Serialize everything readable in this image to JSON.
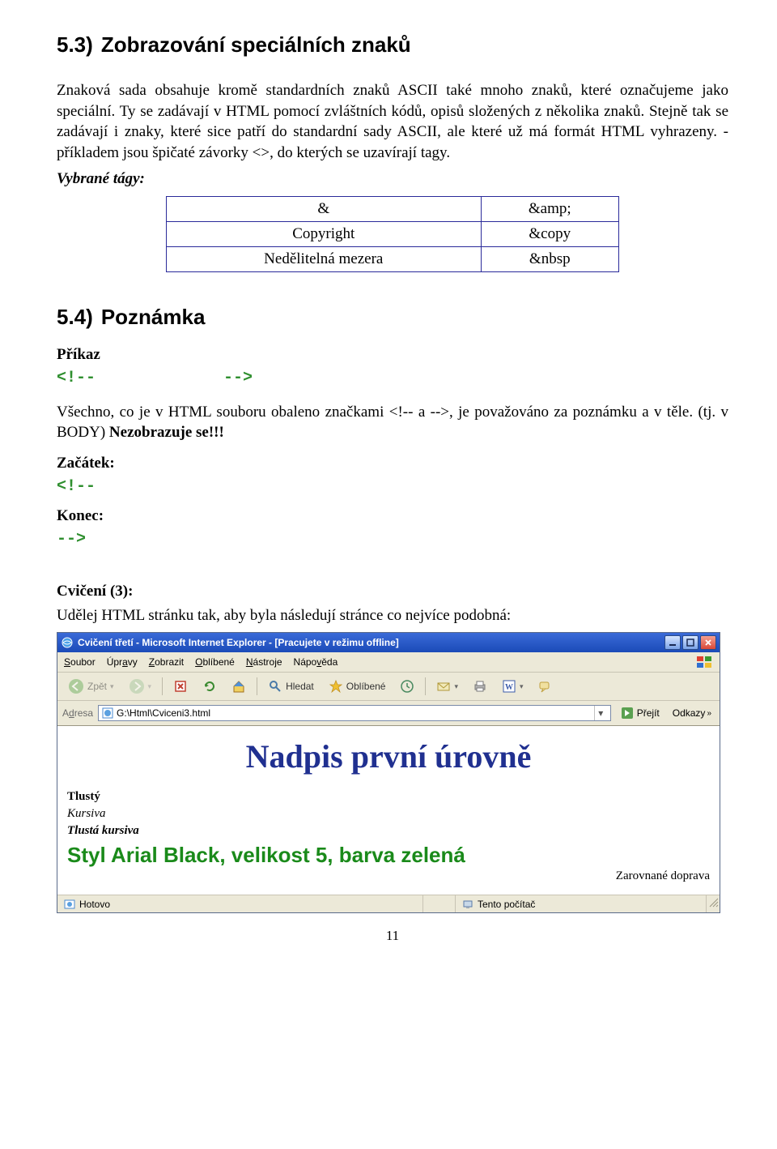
{
  "sections": {
    "s53": {
      "num": "5.3)",
      "title": "Zobrazování speciálních znaků"
    },
    "s54": {
      "num": "5.4)",
      "title": "Poznámka"
    }
  },
  "para1": "Znaková sada obsahuje kromě standardních znaků ASCII také mnoho znaků, které označujeme jako speciální. Ty se zadávají v HTML pomocí zvláštních kódů, opisů složených z několika znaků. Stejně tak se zadávají i znaky, které sice patří do standardní sady ASCII, ale které už má formát HTML vyhrazeny. - příkladem jsou špičaté závorky <>, do kterých se uzavírají tagy.",
  "vybrane_tagy_label": "Vybrané tágy:",
  "entity_table": [
    {
      "name": "&",
      "code": "&amp;"
    },
    {
      "name": "Copyright",
      "code": "&copy"
    },
    {
      "name": "Nedělitelná mezera",
      "code": "&nbsp"
    }
  ],
  "prikaz_label": "Příkaz",
  "comment_syntax": {
    "open": "<!--",
    "close": "-->"
  },
  "para2": "Všechno, co je v HTML souboru obaleno značkami <!-- a -->, je považováno za poznámku a v těle. (tj. v BODY) Nezobrazuje se!!!",
  "nezobrazuje_bold": "Nezobrazuje se!!!",
  "zacatek_label": "Začátek:",
  "konec_label": "Konec:",
  "cviceni_label": "Cvičení (3):",
  "cviceni_text": "Udělej HTML stránku tak, aby byla následují stránce co nejvíce podobná:",
  "ie": {
    "title": "Cvičení třetí - Microsoft Internet Explorer - [Pracujete v režimu offline]",
    "menu": [
      "Soubor",
      "Úpravy",
      "Zobrazit",
      "Oblíbené",
      "Nástroje",
      "Nápověda"
    ],
    "toolbar": {
      "back": "Zpět",
      "search": "Hledat",
      "favorites": "Oblíbené"
    },
    "address_label": "Adresa",
    "address_value": "G:\\Html\\Cviceni3.html",
    "go": "Přejít",
    "links": "Odkazy",
    "content": {
      "h1": "Nadpis první úrovně",
      "l1": "Tlustý",
      "l2": "Kursiva",
      "l3": "Tlustá kursiva",
      "l4": "Styl Arial Black, velikost 5, barva zelená",
      "l5": "Zarovnané doprava"
    },
    "status_left": "Hotovo",
    "status_right": "Tento počítač"
  },
  "page_number": "11"
}
